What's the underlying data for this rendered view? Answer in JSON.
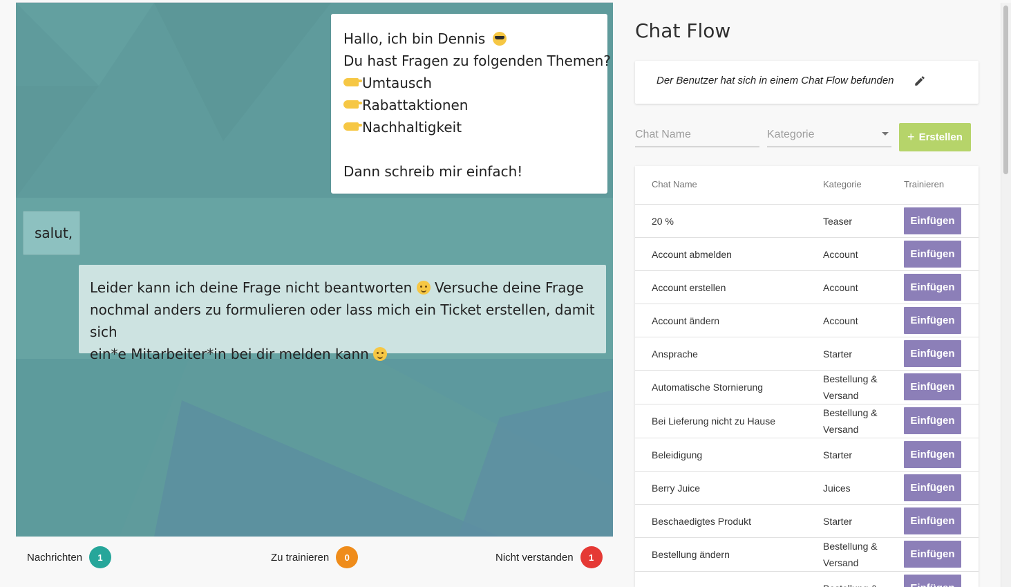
{
  "chat": {
    "bot_intro_lines": [
      "Hallo, ich bin Dennis",
      "Du hast Fragen zu folgenden Themen?",
      "Umtausch",
      "Rabattaktionen",
      "Nachhaltigkeit",
      "Dann schreib mir einfach!"
    ],
    "user_message": "salut,",
    "bot_reply_lines": [
      "Leider kann ich deine Frage nicht beantworten",
      "Versuche deine Frage",
      "nochmal anders zu formulieren oder lass mich ein Ticket erstellen, damit sich",
      "ein*e Mitarbeiter*in bei dir melden kann"
    ],
    "emoji": {
      "sunglasses": "sunglasses-emoji-icon",
      "pensive": "pensive-emoji-icon",
      "smile": "smile-emoji-icon",
      "point": "pointing-hand-icon"
    }
  },
  "stats": {
    "messages": {
      "label": "Nachrichten",
      "count": "1",
      "color": "#26a69a"
    },
    "to_train": {
      "label": "Zu trainieren",
      "count": "0",
      "color": "#ef8c1a"
    },
    "not_understood": {
      "label": "Nicht verstanden",
      "count": "1",
      "color": "#e53935"
    }
  },
  "panel": {
    "title": "Chat Flow",
    "flow_info": "Der Benutzer hat sich in einem Chat Flow befunden",
    "chat_name_placeholder": "Chat Name",
    "category_placeholder": "Kategorie",
    "create_label": "Erstellen"
  },
  "table": {
    "headers": {
      "name": "Chat Name",
      "category": "Kategorie",
      "train": "Trainieren"
    },
    "button_label": "Einfügen",
    "rows": [
      {
        "name": "20 %",
        "category": "Teaser"
      },
      {
        "name": "Account abmelden",
        "category": "Account"
      },
      {
        "name": "Account erstellen",
        "category": "Account"
      },
      {
        "name": "Account ändern",
        "category": "Account"
      },
      {
        "name": "Ansprache",
        "category": "Starter"
      },
      {
        "name": "Automatische Stornierung",
        "category": "Bestellung & Versand"
      },
      {
        "name": "Bei Lieferung nicht zu Hause",
        "category": "Bestellung & Versand"
      },
      {
        "name": "Beleidigung",
        "category": "Starter"
      },
      {
        "name": "Berry Juice",
        "category": "Juices"
      },
      {
        "name": "Beschaedigtes Produkt",
        "category": "Starter"
      },
      {
        "name": "Bestellung ändern",
        "category": "Bestellung & Versand"
      },
      {
        "name": "",
        "category": "Bestellung &"
      }
    ]
  },
  "colors": {
    "accent_green": "#b6d46a",
    "button_purple": "#8c7fb8",
    "chat_bg": "#5f9b9c"
  }
}
